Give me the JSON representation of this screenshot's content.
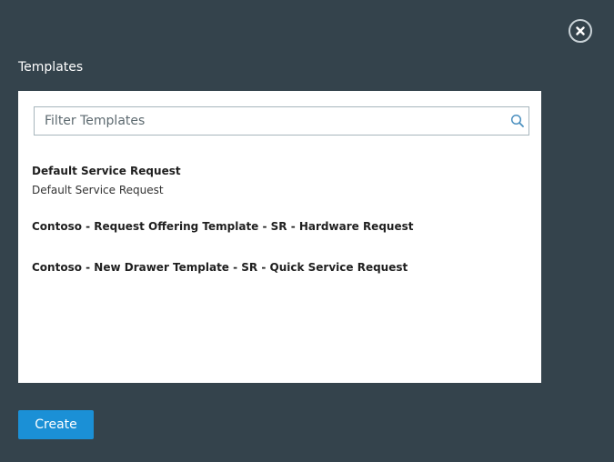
{
  "dialog": {
    "title": "Templates",
    "close_icon": "close-icon"
  },
  "search": {
    "placeholder": "Filter Templates",
    "value": "",
    "icon": "search-icon"
  },
  "templates": [
    {
      "title": "Default Service Request",
      "description": "Default Service Request"
    },
    {
      "title": "Contoso - Request Offering Template - SR - Hardware Request",
      "description": ""
    },
    {
      "title": "Contoso - New Drawer Template - SR - Quick Service Request",
      "description": ""
    }
  ],
  "footer": {
    "create_label": "Create"
  },
  "colors": {
    "background": "#34434c",
    "panel": "#ffffff",
    "accent": "#1b90d6"
  }
}
